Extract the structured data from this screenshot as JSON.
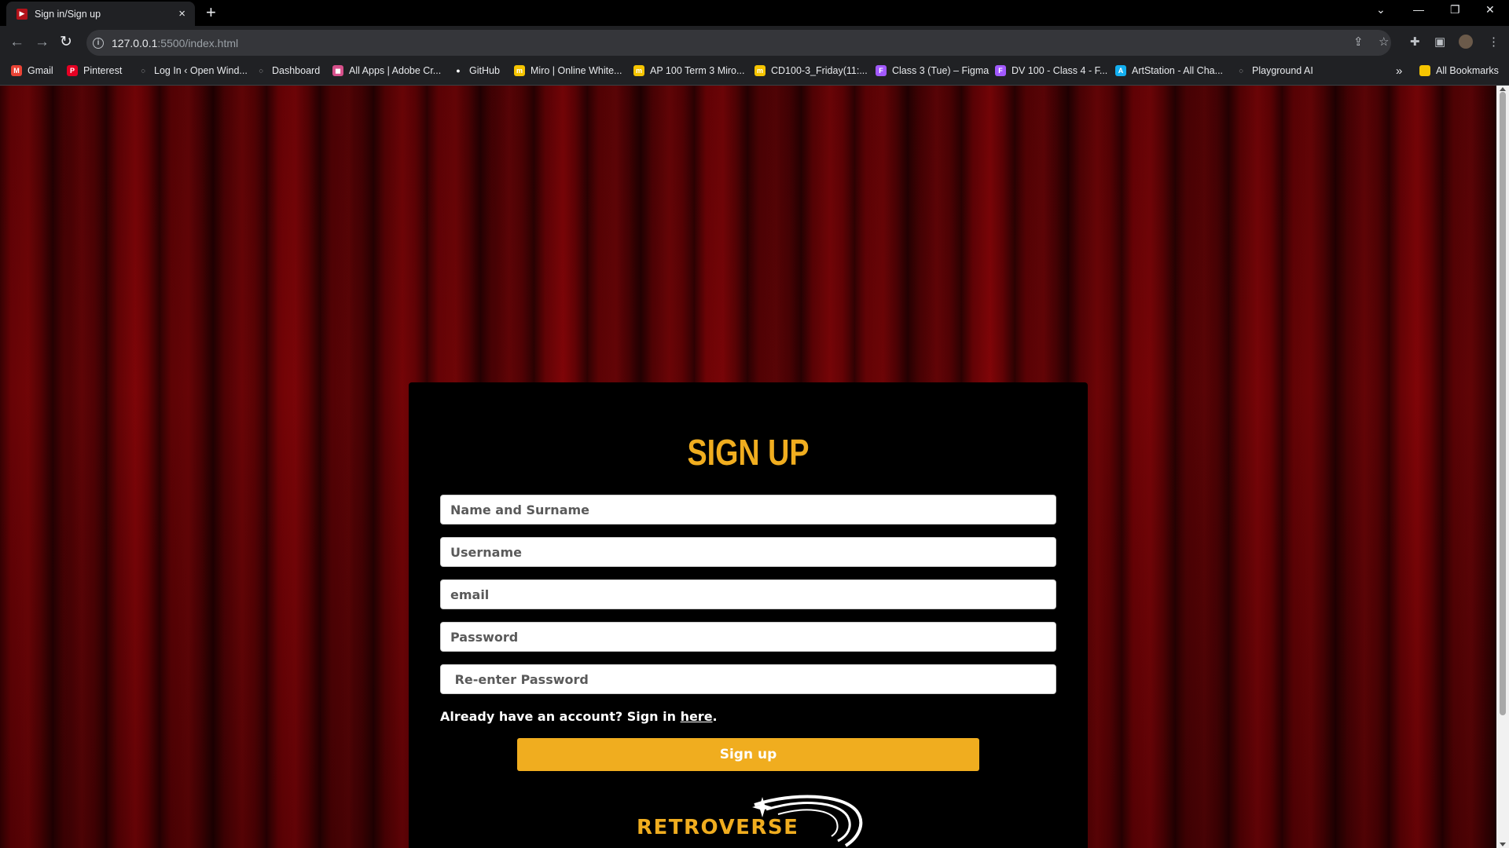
{
  "browser": {
    "tab_title": "Sign in/Sign up",
    "tab_close": "×",
    "new_tab": "+",
    "url_host": "127.0.0.1",
    "url_path": ":5500/index.html",
    "bookmarks": [
      {
        "label": "Gmail",
        "icon": "gmail-icon",
        "color": "#ea4335"
      },
      {
        "label": "Pinterest",
        "icon": "pinterest-icon",
        "color": "#e60023"
      },
      {
        "label": "Log In ‹ Open Wind...",
        "icon": "globe-icon",
        "color": "#202124"
      },
      {
        "label": "Dashboard",
        "icon": "globe-icon",
        "color": "#202124"
      },
      {
        "label": "All Apps | Adobe Cr...",
        "icon": "adobe-icon",
        "color": "#d7508b"
      },
      {
        "label": "GitHub",
        "icon": "github-icon",
        "color": "#202124"
      },
      {
        "label": "Miro | Online White...",
        "icon": "miro-icon",
        "color": "#f5c400"
      },
      {
        "label": "AP 100 Term 3 Miro...",
        "icon": "miro-icon",
        "color": "#f5c400"
      },
      {
        "label": "CD100-3_Friday(11:...",
        "icon": "miro-icon",
        "color": "#f5c400"
      },
      {
        "label": "Class 3 (Tue) – Figma",
        "icon": "figma-icon",
        "color": "#a259ff"
      },
      {
        "label": "DV 100 - Class 4 - F...",
        "icon": "figma-icon",
        "color": "#a259ff"
      },
      {
        "label": "ArtStation - All Cha...",
        "icon": "artstation-icon",
        "color": "#13aff0"
      },
      {
        "label": "Playground AI",
        "icon": "globe-icon",
        "color": "#202124"
      }
    ],
    "bookmarks_more": "»",
    "all_bookmarks": "All Bookmarks"
  },
  "page": {
    "title": "SIGN UP",
    "fields": {
      "name_placeholder": "Name and Surname",
      "username_placeholder": "Username",
      "email_placeholder": "email",
      "password_placeholder": "Password",
      "reenter_placeholder": " Re-enter Password"
    },
    "signin_prefix": "Already have an account? Sign in ",
    "signin_link": "here",
    "signin_suffix": ".",
    "submit_label": "Sign up",
    "logo_text": "RETROVERSE",
    "accent_color": "#f0ad1f"
  }
}
